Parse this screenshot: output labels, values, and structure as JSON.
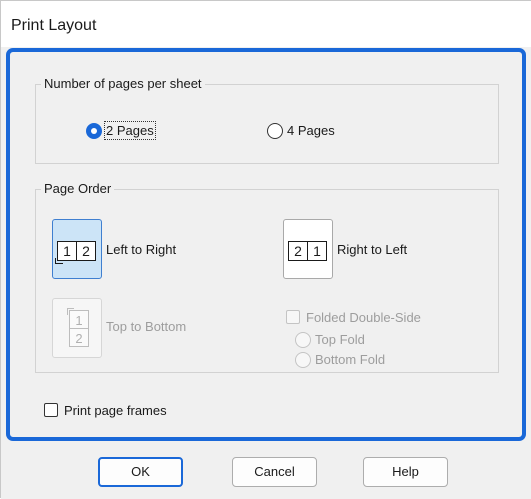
{
  "window": {
    "title": "Print Layout"
  },
  "pages_per_sheet": {
    "group_label": "Number of pages per sheet",
    "options": [
      {
        "label": "2 Pages",
        "selected": true
      },
      {
        "label": "4 Pages",
        "selected": false
      }
    ]
  },
  "page_order": {
    "group_label": "Page Order",
    "left_to_right": {
      "label": "Left to Right",
      "icon": "left-to-right-order-icon",
      "glyphs": [
        "1",
        "2"
      ],
      "selected": true
    },
    "right_to_left": {
      "label": "Right to Left",
      "icon": "right-to-left-order-icon",
      "glyphs": [
        "2",
        "1"
      ],
      "selected": false
    },
    "top_to_bottom": {
      "label": "Top to Bottom",
      "icon": "top-to-bottom-order-icon",
      "glyphs": [
        "1",
        "2"
      ],
      "enabled": false
    },
    "folded_double_side": {
      "label": "Folded Double-Side",
      "checked": false,
      "enabled": false
    },
    "fold_options": [
      {
        "label": "Top Fold",
        "enabled": false
      },
      {
        "label": "Bottom Fold",
        "enabled": false
      }
    ]
  },
  "print_page_frames": {
    "label": "Print page frames",
    "checked": false
  },
  "buttons": {
    "ok": "OK",
    "cancel": "Cancel",
    "help": "Help"
  },
  "colors": {
    "accent": "#1a68d8",
    "selected_fill": "#cce4f7",
    "disabled_text": "#9d9d9d"
  }
}
